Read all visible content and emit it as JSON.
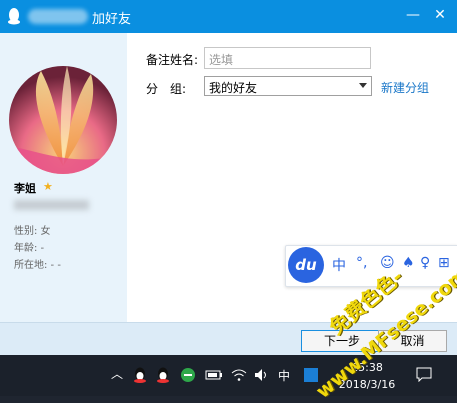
{
  "window": {
    "title": "加好友",
    "minimize_glyph": "—",
    "close_glyph": "✕"
  },
  "profile": {
    "nickname": "李姐",
    "gender": "性别: 女",
    "age": "年龄: -",
    "location": "所在地: -    -"
  },
  "form": {
    "remark_label": "备注姓名:",
    "remark_placeholder": "选填",
    "group_label": "分　组:",
    "group_value": "我的好友",
    "new_group_link": "新建分组"
  },
  "footer": {
    "next_button": "下一步",
    "cancel_button": "取消"
  },
  "ime_toolbar": {
    "logo": "du",
    "mode": "中",
    "punct": "°,",
    "emoji": "☺",
    "skin": "♠",
    "user": "♀",
    "grid": "⊞"
  },
  "taskbar": {
    "ime_mode": "中",
    "time": "15:38",
    "date": "2018/3/16"
  },
  "watermark": {
    "line1": "免费色色-",
    "line2": "www.MFsese.com"
  },
  "colors": {
    "titlebar": "#0a8fe0",
    "link": "#1a77c8",
    "star": "#f2b01e",
    "watermark": "#f0d80c"
  }
}
